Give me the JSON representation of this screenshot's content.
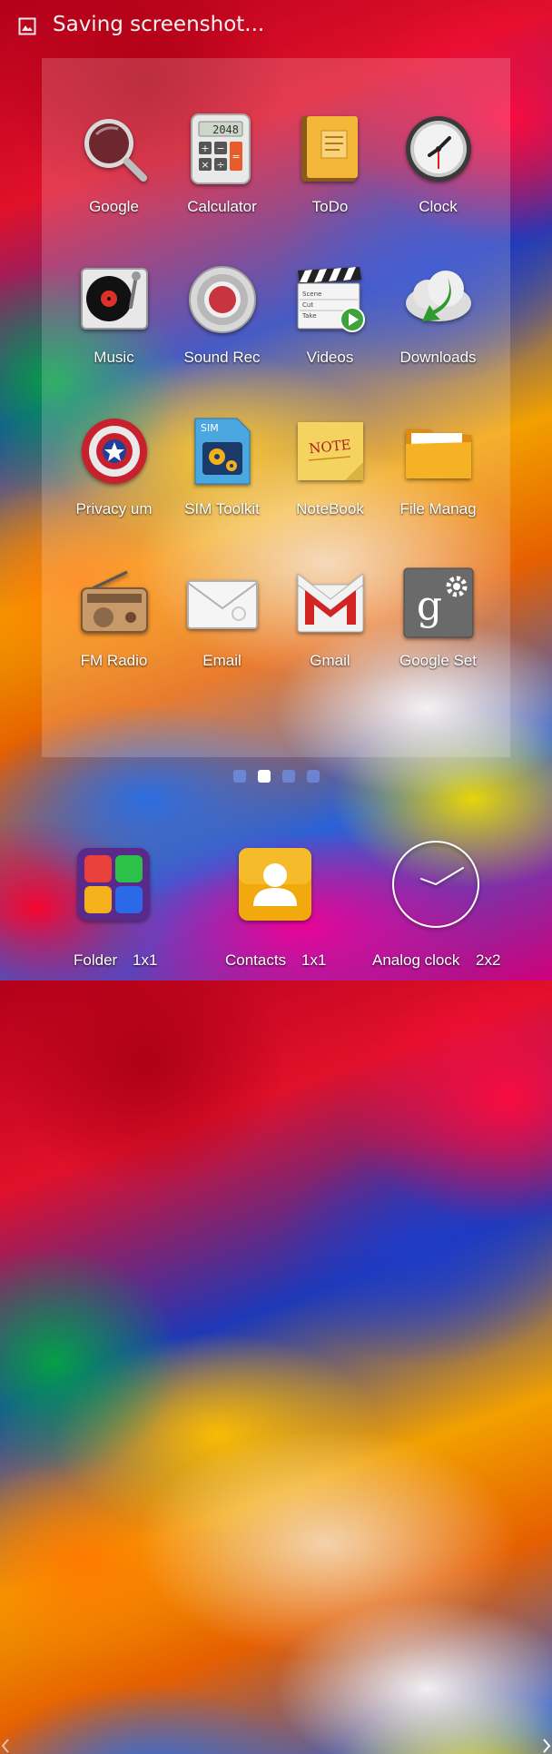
{
  "status_bar": {
    "notification_text": "Saving screenshot...",
    "icon": "image-icon"
  },
  "apps": [
    {
      "label": "Google",
      "icon": "magnifier-icon"
    },
    {
      "label": "Calculator",
      "icon": "calculator-icon",
      "display": "2048"
    },
    {
      "label": "ToDo",
      "icon": "notepad-icon"
    },
    {
      "label": "Clock",
      "icon": "clock-icon"
    },
    {
      "label": "Music",
      "icon": "turntable-icon"
    },
    {
      "label": "Sound Rec",
      "icon": "record-icon"
    },
    {
      "label": "Videos",
      "icon": "clapperboard-icon",
      "board_lines": [
        "Scene",
        "Cut",
        "Take"
      ]
    },
    {
      "label": "Downloads",
      "icon": "cloud-download-icon"
    },
    {
      "label": "Privacy um",
      "icon": "shield-icon"
    },
    {
      "label": "SIM Toolkit",
      "icon": "sim-card-icon",
      "chip_text": "SIM"
    },
    {
      "label": "NoteBook",
      "icon": "sticky-note-icon",
      "note_text": "NOTE"
    },
    {
      "label": "File Manag",
      "icon": "folder-icon"
    },
    {
      "label": "FM Radio",
      "icon": "radio-icon"
    },
    {
      "label": "Email",
      "icon": "envelope-icon"
    },
    {
      "label": "Gmail",
      "icon": "gmail-icon"
    },
    {
      "label": "Google Set",
      "icon": "google-settings-icon",
      "glyph": "g"
    }
  ],
  "pager": {
    "count": 4,
    "active_index": 1
  },
  "dock": [
    {
      "label": "Folder",
      "size": "1x1",
      "icon": "folder-widget-icon"
    },
    {
      "label": "Contacts",
      "size": "1x1",
      "icon": "contacts-icon"
    },
    {
      "label": "Analog clock",
      "size": "2x2",
      "icon": "analog-clock-icon"
    }
  ],
  "colors": {
    "drawer_panel": "#ffffff2e",
    "dot_active": "#ffffff",
    "dot_inactive": "#78a0ff8c"
  }
}
